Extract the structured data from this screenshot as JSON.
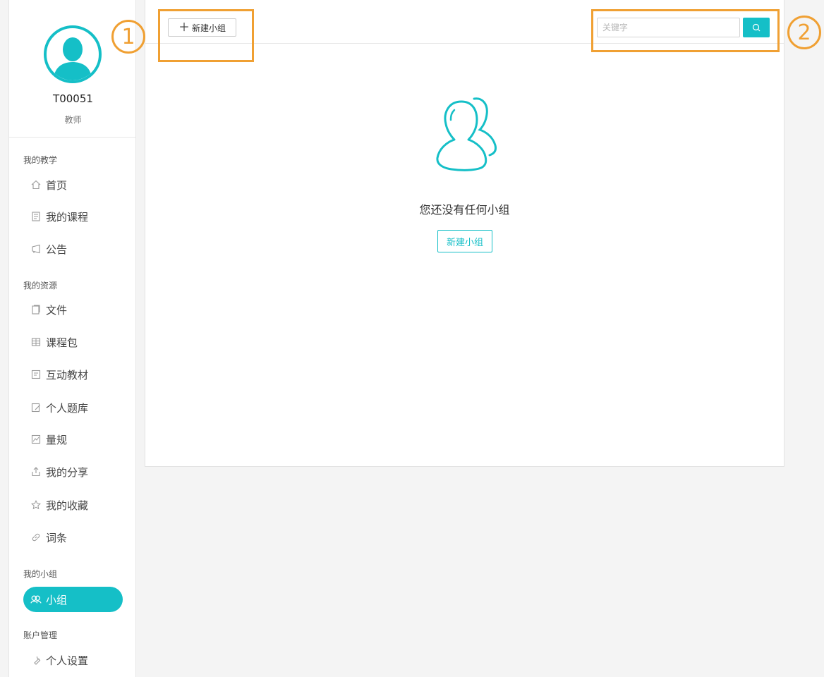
{
  "user": {
    "id": "T00051",
    "role": "教师"
  },
  "sidebar": {
    "sections": [
      {
        "title": "我的教学",
        "items": [
          {
            "label": "首页",
            "icon": "home-icon"
          },
          {
            "label": "我的课程",
            "icon": "course-icon"
          },
          {
            "label": "公告",
            "icon": "announcement-icon"
          }
        ]
      },
      {
        "title": "我的资源",
        "items": [
          {
            "label": "文件",
            "icon": "file-icon"
          },
          {
            "label": "课程包",
            "icon": "package-icon"
          },
          {
            "label": "互动教材",
            "icon": "interactive-book-icon"
          },
          {
            "label": "个人题库",
            "icon": "question-bank-icon"
          },
          {
            "label": "量规",
            "icon": "rubric-icon"
          },
          {
            "label": "我的分享",
            "icon": "share-icon"
          },
          {
            "label": "我的收藏",
            "icon": "star-icon"
          },
          {
            "label": "词条",
            "icon": "link-icon"
          }
        ]
      },
      {
        "title": "我的小组",
        "items": [
          {
            "label": "小组",
            "icon": "group-icon",
            "active": true
          }
        ]
      },
      {
        "title": "账户管理",
        "items": [
          {
            "label": "个人设置",
            "icon": "wrench-icon"
          }
        ]
      }
    ]
  },
  "toolbar": {
    "new_group_label": "新建小组",
    "search_placeholder": "关键字"
  },
  "empty_state": {
    "message": "您还没有任何小组",
    "create_label": "新建小组"
  },
  "annotations": {
    "callout_1": "1",
    "callout_2": "2"
  },
  "colors": {
    "accent": "#15bfc7",
    "callout": "#f0a033"
  }
}
